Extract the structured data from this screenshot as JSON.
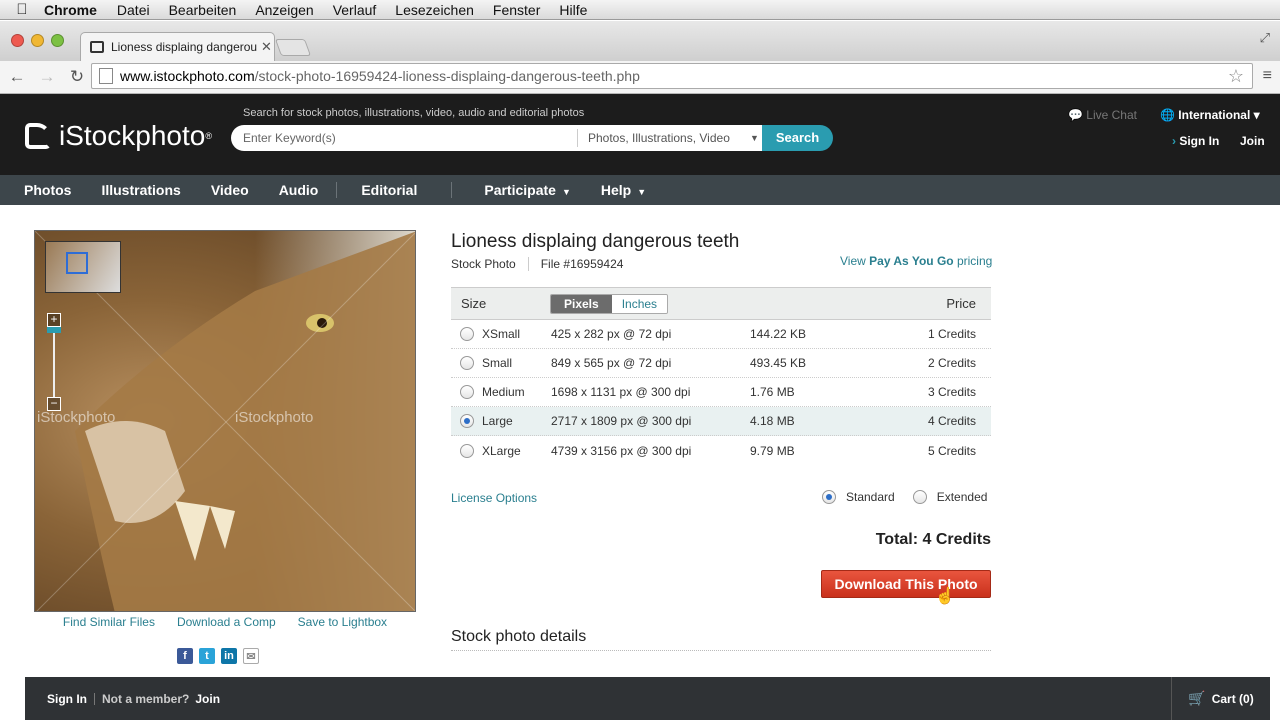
{
  "macmenu": {
    "apple": "",
    "app": "Chrome",
    "items": [
      "Datei",
      "Bearbeiten",
      "Anzeigen",
      "Verlauf",
      "Lesezeichen",
      "Fenster",
      "Hilfe"
    ]
  },
  "browser": {
    "tab_title": "Lioness displaing dangerous teeth",
    "url_domain": "www.istockphoto.com",
    "url_path": "/stock-photo-16959424-lioness-displaing-dangerous-teeth.php"
  },
  "header": {
    "logo": "iStockphoto",
    "logo_mark": "®",
    "search_hint": "Search for stock photos, illustrations, video, audio and editorial photos",
    "search_placeholder": "Enter Keyword(s)",
    "search_category": "Photos, Illustrations, Video",
    "search_button": "Search",
    "live_chat": "Live Chat",
    "international": "International",
    "sign_in": "Sign In",
    "join": "Join"
  },
  "nav": {
    "items": [
      "Photos",
      "Illustrations",
      "Video",
      "Audio",
      "Editorial"
    ],
    "participate": "Participate",
    "help": "Help"
  },
  "photo": {
    "watermark": "iStockphoto",
    "actions": [
      "Find Similar Files",
      "Download a Comp",
      "Save to Lightbox"
    ]
  },
  "detail": {
    "title": "Lioness displaing dangerous teeth",
    "type": "Stock Photo",
    "file": "File #16959424",
    "paygo_pre": "View",
    "paygo_bold": "Pay As You Go",
    "paygo_post": "pricing",
    "size_header": "Size",
    "unit_pixels": "Pixels",
    "unit_inches": "Inches",
    "price_header": "Price",
    "rows": [
      {
        "name": "XSmall",
        "dims": "425 x 282 px @ 72 dpi",
        "size": "144.22 KB",
        "credits": "1 Credits"
      },
      {
        "name": "Small",
        "dims": "849 x 565 px @ 72 dpi",
        "size": "493.45 KB",
        "credits": "2 Credits"
      },
      {
        "name": "Medium",
        "dims": "1698 x 1131 px @ 300 dpi",
        "size": "1.76 MB",
        "credits": "3 Credits"
      },
      {
        "name": "Large",
        "dims": "2717 x 1809 px @ 300 dpi",
        "size": "4.18 MB",
        "credits": "4 Credits"
      },
      {
        "name": "XLarge",
        "dims": "4739 x 3156 px @ 300 dpi",
        "size": "9.79 MB",
        "credits": "5 Credits"
      }
    ],
    "license_options": "License Options",
    "standard": "Standard",
    "extended": "Extended",
    "total": "Total: 4 Credits",
    "download": "Download This Photo",
    "details_heading": "Stock photo details"
  },
  "bottombar": {
    "sign_in": "Sign In",
    "not_member": "Not a member?",
    "join": "Join",
    "cart": "Cart (0)"
  }
}
